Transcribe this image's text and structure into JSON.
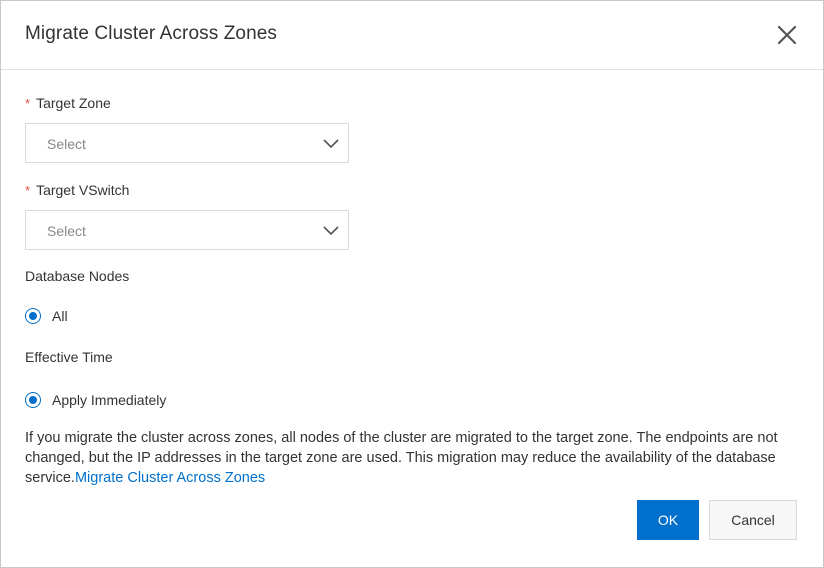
{
  "dialog": {
    "title": "Migrate Cluster Across Zones",
    "close_icon": "close-icon"
  },
  "form": {
    "target_zone": {
      "required_mark": "*",
      "label": "Target Zone",
      "placeholder": "Select",
      "icon": "chevron-down-icon"
    },
    "target_vswitch": {
      "required_mark": "*",
      "label": "Target VSwitch",
      "placeholder": "Select",
      "icon": "chevron-down-icon"
    },
    "database_nodes": {
      "label": "Database Nodes",
      "option": "All",
      "selected": true
    },
    "effective_time": {
      "label": "Effective Time",
      "option": "Apply Immediately",
      "selected": true
    }
  },
  "note": {
    "text": "If you migrate the cluster across zones, all nodes of the cluster are migrated to the target zone. The endpoints are not changed, but the IP addresses in the target zone are used. This migration may reduce the availability of the database service.",
    "link_text": "Migrate Cluster Across Zones"
  },
  "footer": {
    "ok_label": "OK",
    "cancel_label": "Cancel"
  },
  "colors": {
    "primary": "#0070cc",
    "required": "#e0503c",
    "border": "#d9d9d9",
    "text": "#333333"
  }
}
